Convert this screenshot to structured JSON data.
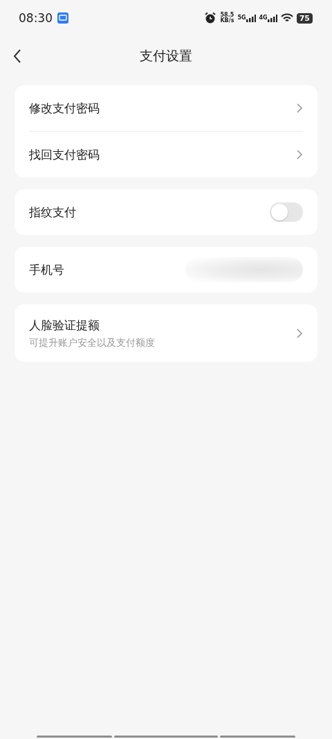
{
  "status_bar": {
    "time": "08:30",
    "speed": "58.5",
    "speed_unit": "KB/s",
    "sim_1": "5G",
    "sim_2": "4G",
    "battery": "75"
  },
  "header": {
    "title": "支付设置"
  },
  "groups": [
    {
      "items": [
        {
          "kind": "link",
          "label": "修改支付密码"
        },
        {
          "kind": "link",
          "label": "找回支付密码"
        }
      ]
    },
    {
      "items": [
        {
          "kind": "toggle",
          "label": "指纹支付",
          "on": false
        }
      ]
    },
    {
      "items": [
        {
          "kind": "masked",
          "label": "手机号"
        }
      ]
    },
    {
      "items": [
        {
          "kind": "link",
          "label": "人脸验证提额",
          "subtitle": "可提升账户安全以及支付额度"
        }
      ]
    }
  ]
}
